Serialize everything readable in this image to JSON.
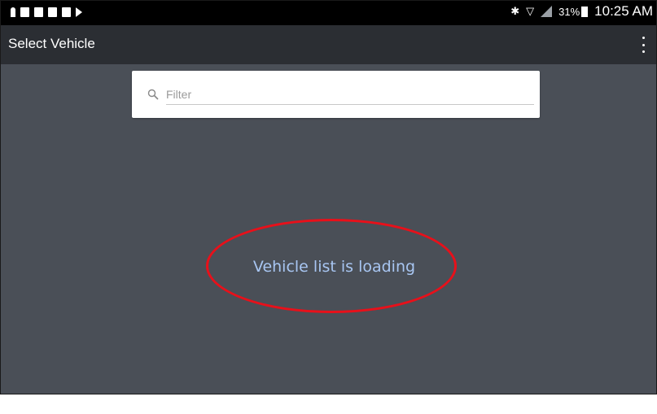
{
  "status_bar": {
    "left_icons": [
      "person-icon",
      "phone-icon",
      "mail-icon",
      "image-icon",
      "unknown-icon",
      "flag-icon"
    ],
    "right_icons": [
      "bluetooth-icon",
      "wifi-icon",
      "signal-icon",
      "battery-icon"
    ],
    "battery_percent": "31%",
    "time": "10:25 AM"
  },
  "app_bar": {
    "title": "Select Vehicle",
    "menu_icon": "more-vert-icon"
  },
  "search": {
    "placeholder": "Filter",
    "value": ""
  },
  "main": {
    "loading_message": "Vehicle list is loading"
  },
  "colors": {
    "status_bar_bg": "#000000",
    "app_bar_bg": "#2b2e33",
    "content_bg": "#4a4f57",
    "loading_text": "#a8c6f2",
    "highlight_ellipse": "#e8101a"
  }
}
